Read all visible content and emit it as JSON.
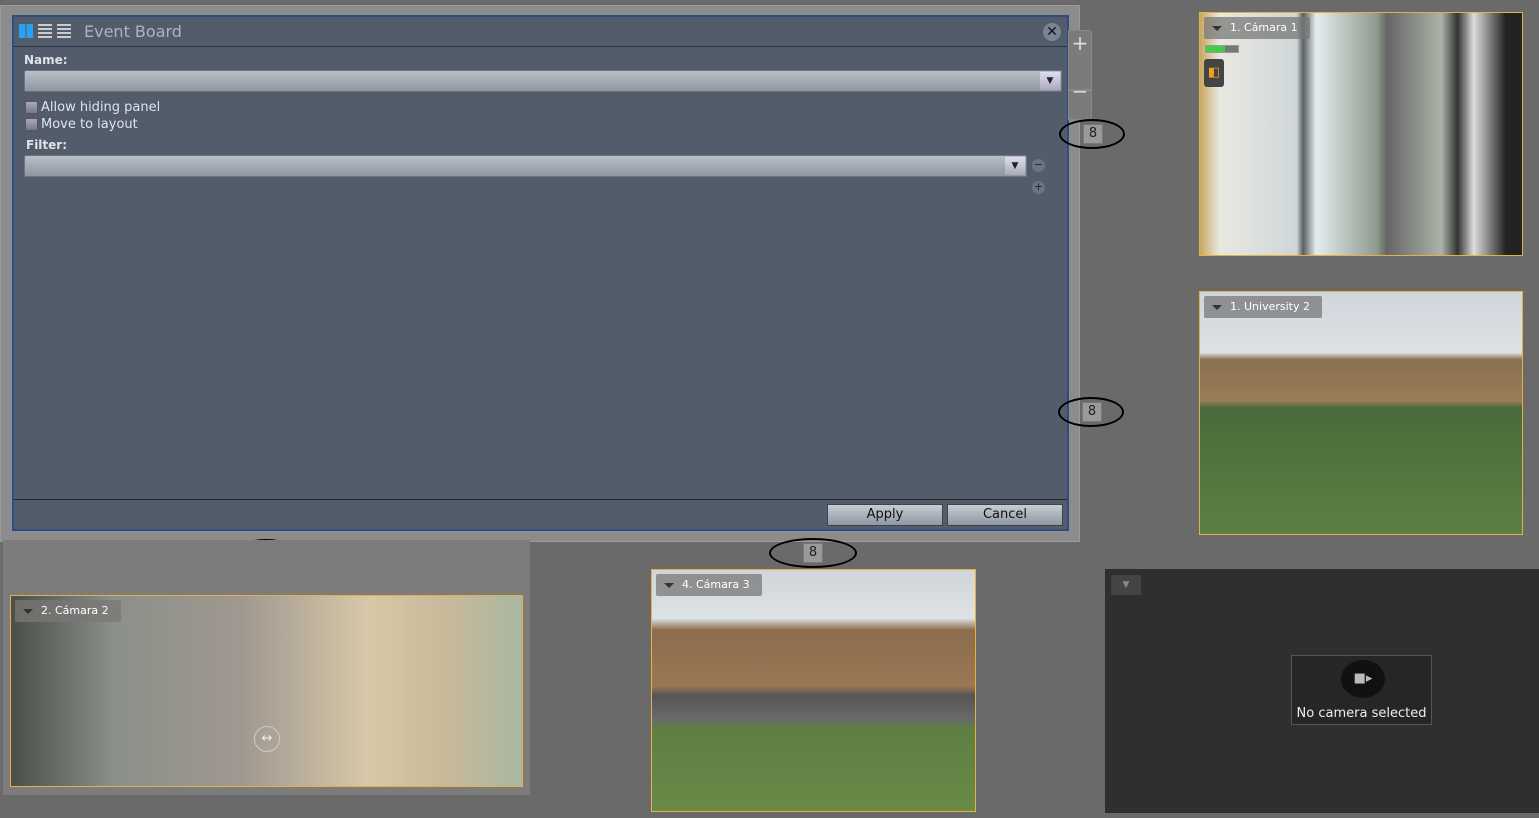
{
  "dialog": {
    "title": "Event Board",
    "name_label": "Name:",
    "name_value": "",
    "allow_hiding": "Allow hiding panel",
    "move_layout": "Move to layout",
    "filter_label": "Filter:",
    "filter_value": "",
    "apply": "Apply",
    "cancel": "Cancel"
  },
  "cameras": [
    {
      "label": "1. Cámara 1"
    },
    {
      "label": "1. University 2"
    },
    {
      "label": "2. Cámara 2"
    },
    {
      "label": "4. Cámara 3"
    }
  ],
  "empty_panel": {
    "text": "No camera selected"
  },
  "zoom": {
    "plus": "+",
    "minus": "−"
  }
}
